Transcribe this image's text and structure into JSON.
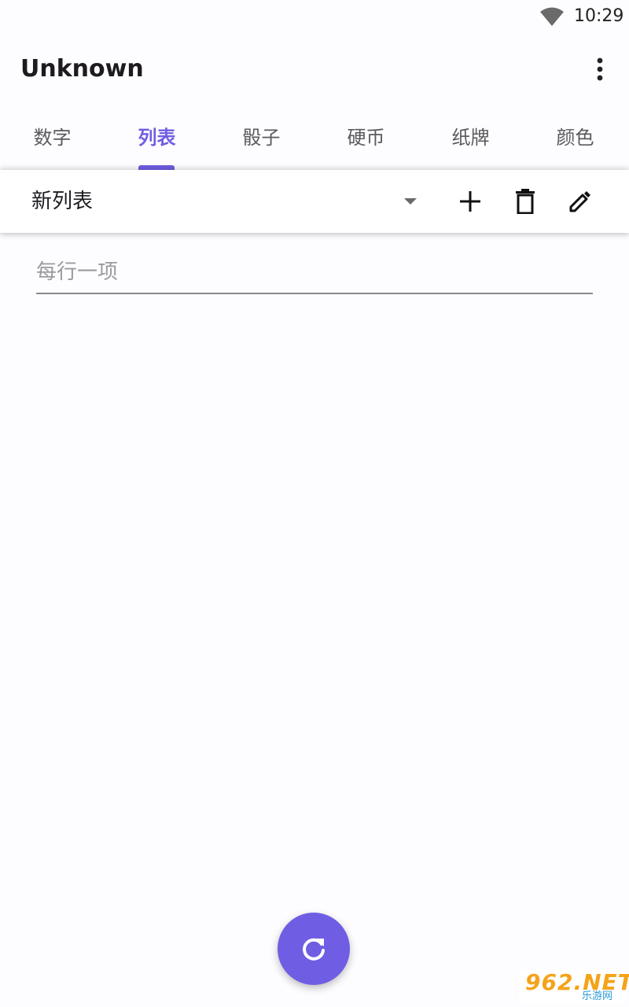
{
  "status_bar": {
    "time": "10:29",
    "wifi_icon": "wifi-icon"
  },
  "app_bar": {
    "title": "Unknown",
    "menu_icon": "more-vert-icon"
  },
  "tabs": [
    {
      "label": "数字",
      "active": false
    },
    {
      "label": "列表",
      "active": true
    },
    {
      "label": "骰子",
      "active": false
    },
    {
      "label": "硬币",
      "active": false
    },
    {
      "label": "纸牌",
      "active": false
    },
    {
      "label": "颜色",
      "active": false
    }
  ],
  "list_toolbar": {
    "selected_list": "新列表",
    "dropdown_icon": "arrow-drop-down-icon",
    "add_icon": "plus-icon",
    "delete_icon": "trash-icon",
    "edit_icon": "pencil-icon"
  },
  "items_input": {
    "value": "",
    "placeholder": "每行一项"
  },
  "fab": {
    "icon": "refresh-icon"
  },
  "watermark": {
    "text": "962.NET",
    "sub": "乐游网"
  },
  "colors": {
    "accent": "#6f5ee3",
    "background": "#fdfcfe"
  }
}
